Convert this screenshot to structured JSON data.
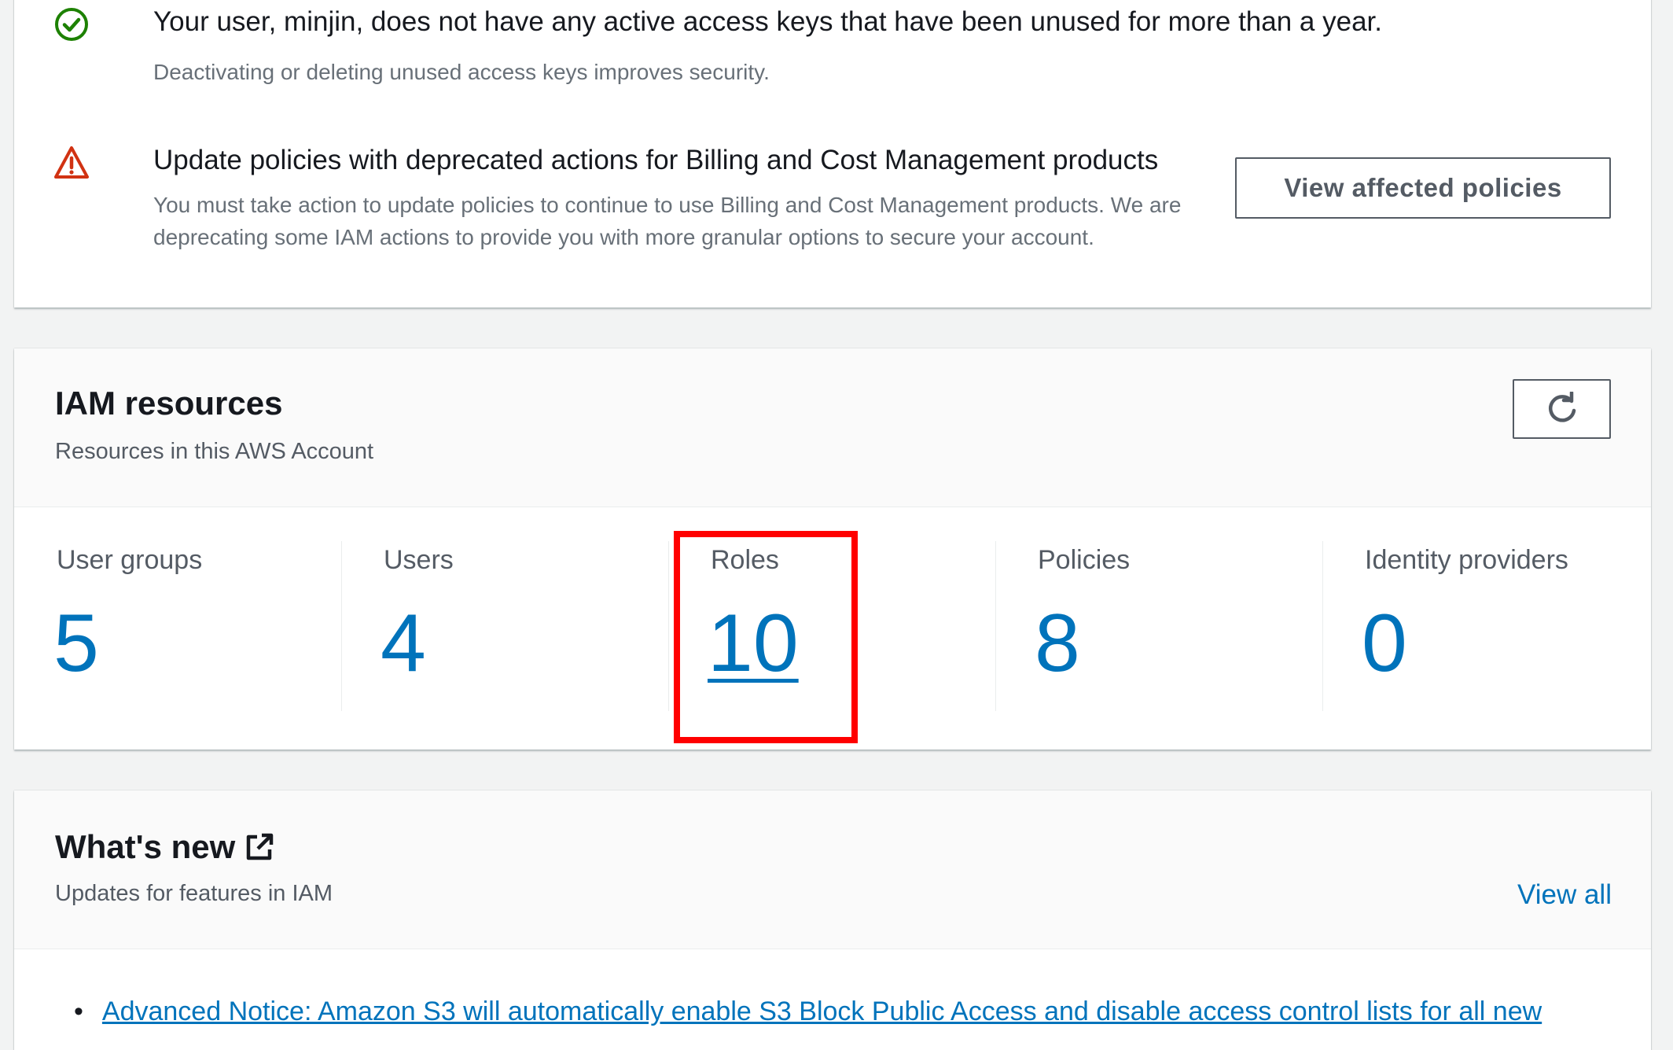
{
  "security": {
    "alerts": [
      {
        "status": "success",
        "icon": "check-circle-icon",
        "title": "Your user, minjin, does not have any active access keys that have been unused for more than a year.",
        "description": "Deactivating or deleting unused access keys improves security."
      },
      {
        "status": "warning",
        "icon": "warning-triangle-icon",
        "title": "Update policies with deprecated actions for Billing and Cost Management products",
        "description": "You must take action to update policies to continue to use Billing and Cost Management products. We are deprecating some IAM actions to provide you with more granular options to secure your account.",
        "action_label": "View affected policies"
      }
    ]
  },
  "resources": {
    "title": "IAM resources",
    "subtitle": "Resources in this AWS Account",
    "refresh_icon": "refresh-icon",
    "counters": [
      {
        "label": "User groups",
        "value": "5"
      },
      {
        "label": "Users",
        "value": "4"
      },
      {
        "label": "Roles",
        "value": "10"
      },
      {
        "label": "Policies",
        "value": "8"
      },
      {
        "label": "Identity providers",
        "value": "0"
      }
    ]
  },
  "whats_new": {
    "title": "What's new",
    "title_icon": "external-link-icon",
    "subtitle": "Updates for features in IAM",
    "view_all_label": "View all",
    "items": [
      "Advanced Notice: Amazon S3 will automatically enable S3 Block Public Access and disable access control lists for all new"
    ]
  },
  "colors": {
    "link": "#0073bb",
    "success": "#1d8102",
    "warning": "#d13212",
    "highlight": "#ff0000",
    "background": "#f2f3f3"
  }
}
